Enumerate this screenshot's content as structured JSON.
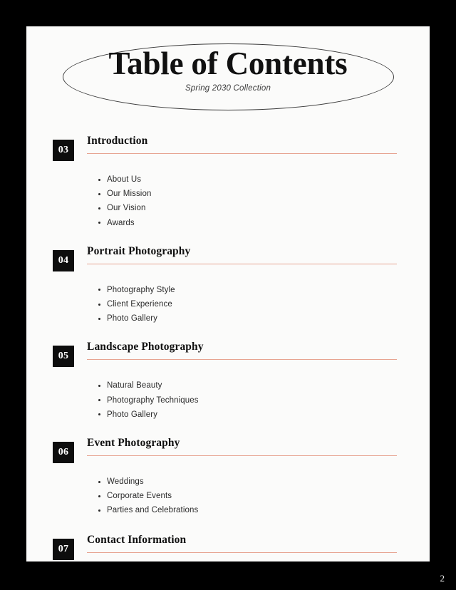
{
  "document": {
    "title": "Table of Contents",
    "subtitle": "Spring 2030 Collection",
    "page_number": "2",
    "colors": {
      "frame": "#000000",
      "page": "#FBFBFA",
      "rule": "#E7A491",
      "badge": "#0D0D0D",
      "badge_text": "#FFFFFF",
      "heading": "#111111",
      "body_text": "#2B2B2B"
    }
  },
  "sections": [
    {
      "number": "03",
      "title": "Introduction",
      "items": [
        "About Us",
        "Our Mission",
        "Our Vision",
        "Awards"
      ]
    },
    {
      "number": "04",
      "title": "Portrait Photography",
      "items": [
        "Photography Style",
        "Client Experience",
        "Photo Gallery"
      ]
    },
    {
      "number": "05",
      "title": "Landscape Photography",
      "items": [
        "Natural Beauty",
        "Photography Techniques",
        "Photo Gallery"
      ]
    },
    {
      "number": "06",
      "title": "Event Photography",
      "items": [
        "Weddings",
        "Corporate Events",
        "Parties and Celebrations"
      ]
    },
    {
      "number": "07",
      "title": "Contact Information",
      "items": []
    }
  ]
}
